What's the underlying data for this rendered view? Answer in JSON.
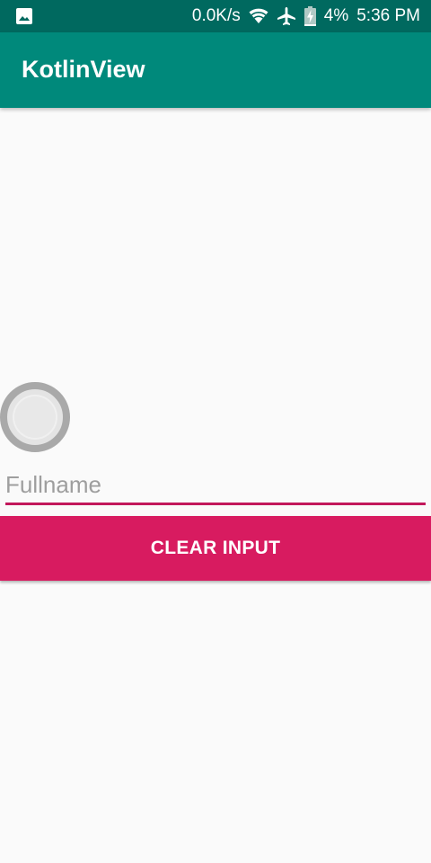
{
  "status_bar": {
    "network_speed": "0.0K/s",
    "battery": "4%",
    "time": "5:36 PM",
    "icons": [
      "image-notification-icon",
      "wifi-icon",
      "airplane-icon",
      "battery-charging-icon"
    ]
  },
  "app_bar": {
    "title": "KotlinView",
    "color": "#00897b"
  },
  "form": {
    "name_placeholder": "Fullname",
    "name_value": "",
    "clear_button_label": "CLEAR INPUT",
    "accent_color": "#d81b60"
  }
}
